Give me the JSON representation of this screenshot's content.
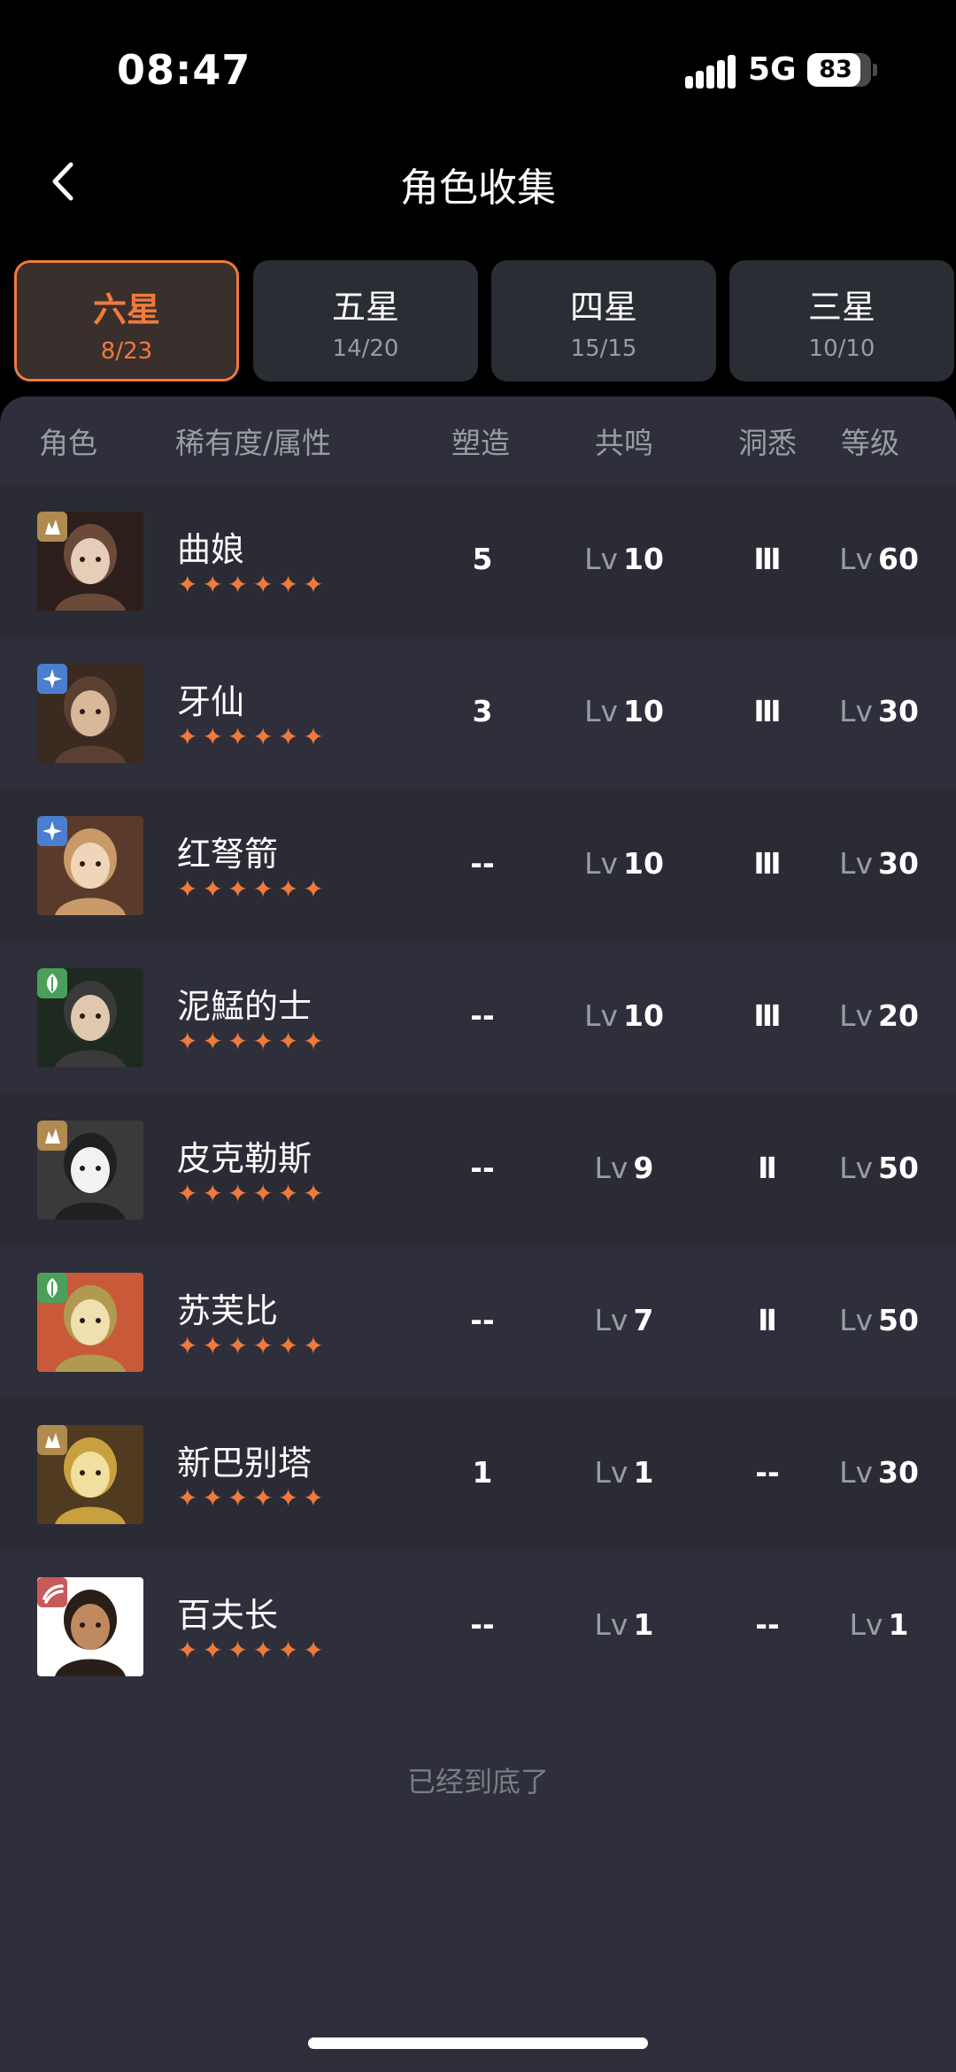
{
  "status_bar": {
    "time": "08:47",
    "network": "5G",
    "battery": "83"
  },
  "nav": {
    "title": "角色收集",
    "back_icon": "chevron-left-icon"
  },
  "tabs": [
    {
      "label": "六星",
      "count": "8/23",
      "active": true
    },
    {
      "label": "五星",
      "count": "14/20",
      "active": false
    },
    {
      "label": "四星",
      "count": "15/15",
      "active": false
    },
    {
      "label": "三星",
      "count": "10/10",
      "active": false
    }
  ],
  "table": {
    "headers": {
      "character": "角色",
      "rarity": "稀有度/属性",
      "shaping": "塑造",
      "resonance": "共鸣",
      "insight": "洞悉",
      "level": "等级"
    },
    "level_prefix": "Lv",
    "rows": [
      {
        "name": "曲娘",
        "stars": "✦✦✦✦✦✦",
        "attribute": "beast-icon",
        "attr_color": "#b08a4f",
        "shaping": "5",
        "resonance": "10",
        "insight": "Ⅲ",
        "level": "60"
      },
      {
        "name": "牙仙",
        "stars": "✦✦✦✦✦✦",
        "attribute": "star-icon",
        "attr_color": "#4a7fd0",
        "shaping": "3",
        "resonance": "10",
        "insight": "Ⅲ",
        "level": "30"
      },
      {
        "name": "红弩箭",
        "stars": "✦✦✦✦✦✦",
        "attribute": "star-icon",
        "attr_color": "#4a7fd0",
        "shaping": "--",
        "resonance": "10",
        "insight": "Ⅲ",
        "level": "30"
      },
      {
        "name": "泥鯭的士",
        "stars": "✦✦✦✦✦✦",
        "attribute": "plant-icon",
        "attr_color": "#4aa05a",
        "shaping": "--",
        "resonance": "10",
        "insight": "Ⅲ",
        "level": "20"
      },
      {
        "name": "皮克勒斯",
        "stars": "✦✦✦✦✦✦",
        "attribute": "beast-icon",
        "attr_color": "#b08a4f",
        "shaping": "--",
        "resonance": "9",
        "insight": "Ⅱ",
        "level": "50"
      },
      {
        "name": "苏芙比",
        "stars": "✦✦✦✦✦✦",
        "attribute": "plant-icon",
        "attr_color": "#4aa05a",
        "shaping": "--",
        "resonance": "7",
        "insight": "Ⅱ",
        "level": "50"
      },
      {
        "name": "新巴别塔",
        "stars": "✦✦✦✦✦✦",
        "attribute": "beast-icon",
        "attr_color": "#b08a4f",
        "shaping": "1",
        "resonance": "1",
        "insight": "--",
        "level": "30"
      },
      {
        "name": "百夫长",
        "stars": "✦✦✦✦✦✦",
        "attribute": "flame-icon",
        "attr_color": "#c85a5a",
        "shaping": "--",
        "resonance": "1",
        "insight": "--",
        "level": "1"
      }
    ]
  },
  "footer": {
    "end_text": "已经到底了"
  },
  "colors": {
    "accent": "#f07a3c",
    "panel": "#2e2f3a",
    "muted": "#9a9ca4"
  }
}
